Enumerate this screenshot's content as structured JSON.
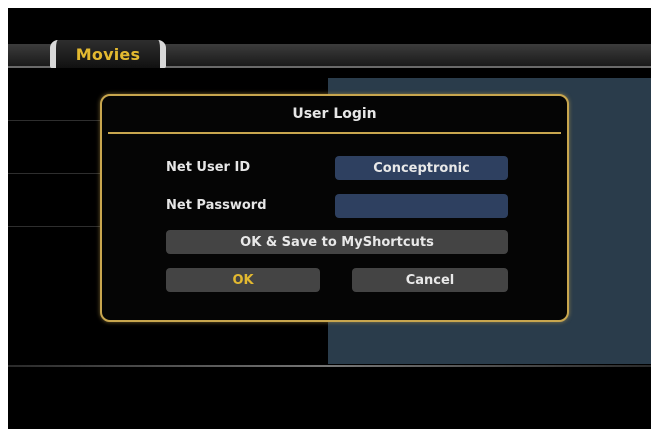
{
  "header": {
    "tab_label": "Movies"
  },
  "dialog": {
    "title": "User Login",
    "user_id_label": "Net User ID",
    "user_id_value": "Conceptronic",
    "password_label": "Net Password",
    "password_value": "",
    "save_button_label": "OK & Save to MyShortcuts",
    "ok_button_label": "OK",
    "cancel_button_label": "Cancel"
  },
  "colors": {
    "accent_gold": "#c8a64e",
    "tab_text": "#e3b930",
    "field_blue": "#2e4060",
    "panel_blue": "#2a3c4b",
    "button_grey": "#444444"
  }
}
